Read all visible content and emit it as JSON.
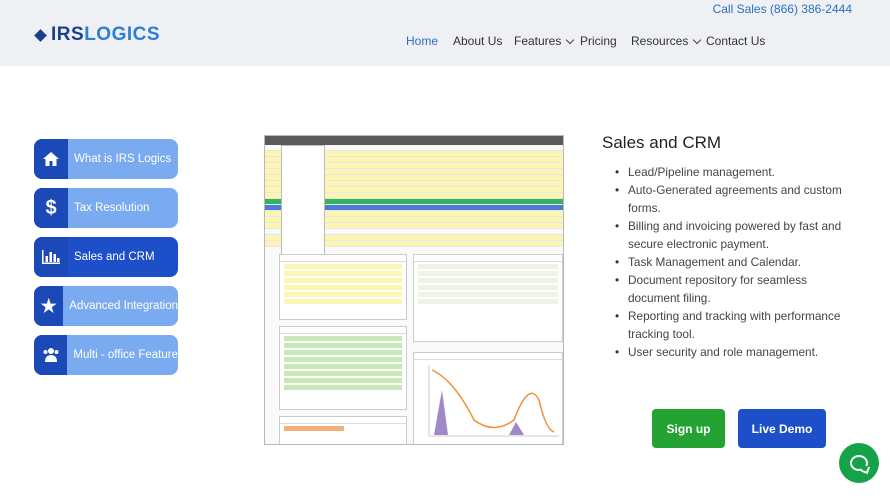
{
  "header": {
    "call_sales": "Call Sales (866) 386-2444",
    "logo": {
      "part1": "IRS",
      "part2": "LOGICS"
    },
    "nav": [
      {
        "label": "Home",
        "active": true,
        "dropdown": false
      },
      {
        "label": "About Us",
        "active": false,
        "dropdown": false
      },
      {
        "label": "Features",
        "active": false,
        "dropdown": true
      },
      {
        "label": "Pricing",
        "active": false,
        "dropdown": false
      },
      {
        "label": "Resources",
        "active": false,
        "dropdown": true
      },
      {
        "label": "Contact Us",
        "active": false,
        "dropdown": false
      }
    ]
  },
  "sidebar": {
    "items": [
      {
        "label": "What is IRS Logics",
        "icon": "home-icon",
        "active": false
      },
      {
        "label": "Tax Resolution",
        "icon": "dollar-icon",
        "active": false
      },
      {
        "label": "Sales and CRM",
        "icon": "bar-chart-icon",
        "active": true
      },
      {
        "label": "Advanced Integration",
        "icon": "star-icon",
        "active": false
      },
      {
        "label": "Multi - office Feature",
        "icon": "users-icon",
        "active": false
      }
    ]
  },
  "content": {
    "title": "Sales and CRM",
    "features": [
      "Lead/Pipeline management.",
      "Auto-Generated agreements and custom forms.",
      "Billing and invoicing powered by fast and secure electronic payment.",
      "Task Management and Calendar.",
      "Document repository for seamless document filing.",
      "Reporting and tracking with performance tracking tool.",
      "User security and role management."
    ]
  },
  "buttons": {
    "signup": "Sign up",
    "demo": "Live Demo"
  },
  "colors": {
    "accent_blue": "#1d4fc9",
    "sidebar_light": "#7aaaf0",
    "signup_green": "#24a332",
    "chat_green": "#15a34a",
    "nav_active": "#2a6fc2"
  }
}
